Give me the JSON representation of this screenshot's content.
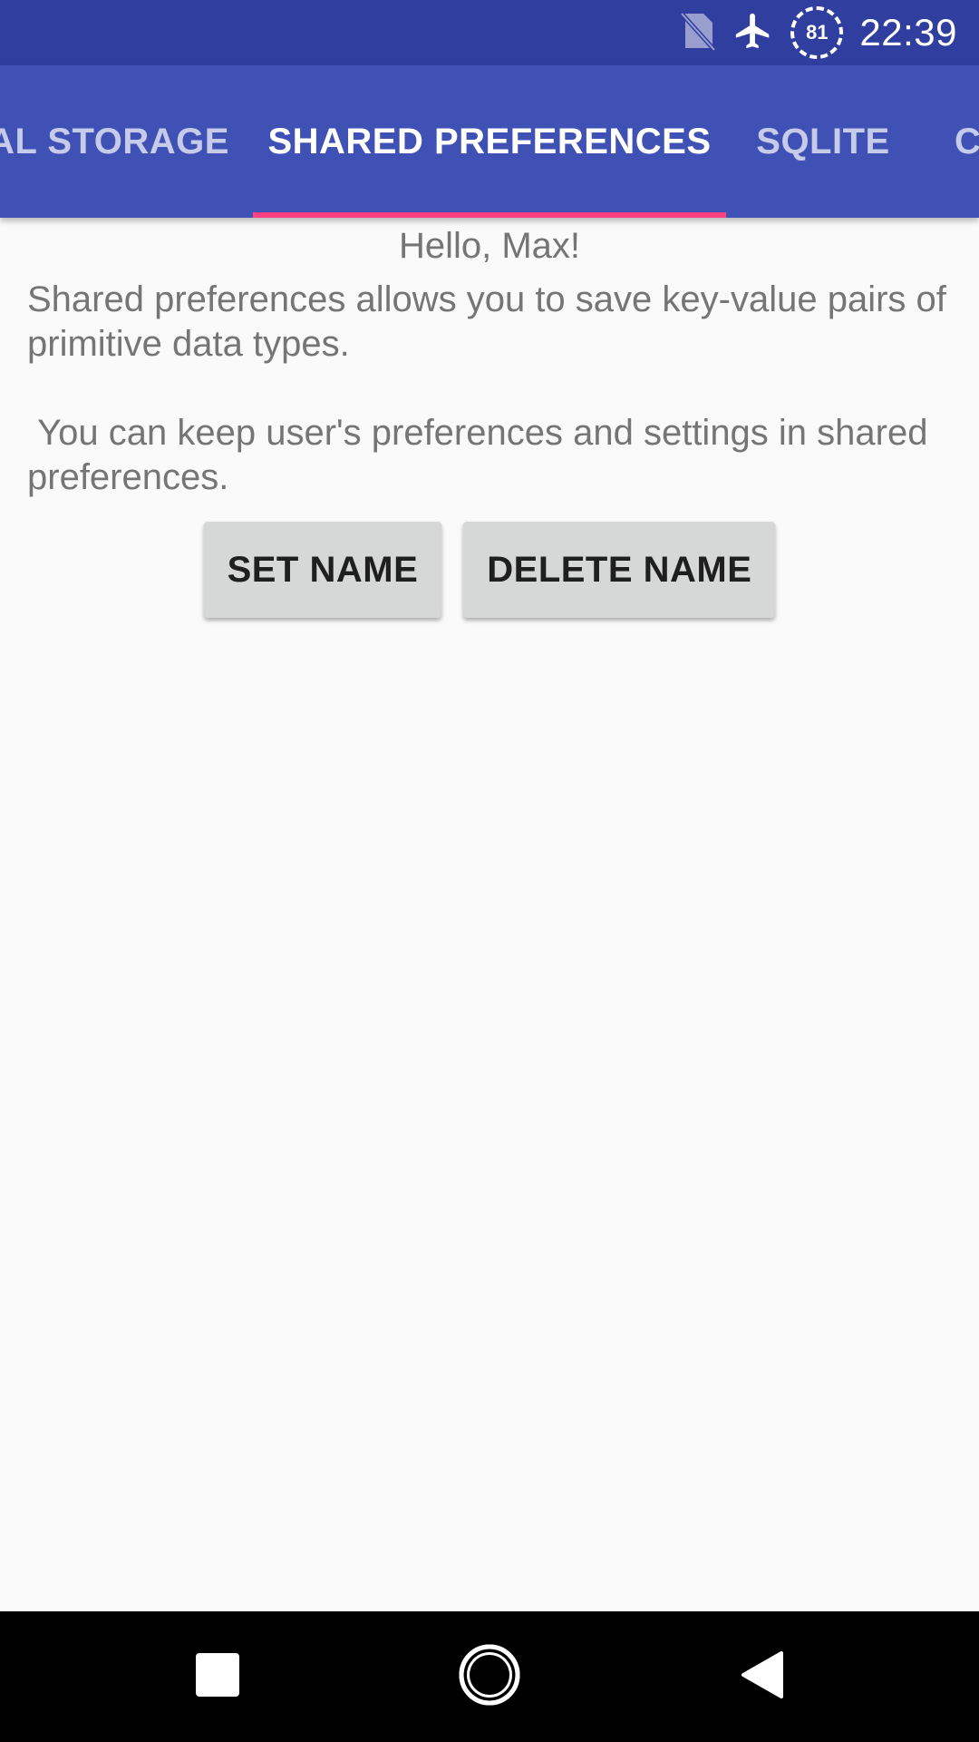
{
  "status_bar": {
    "time": "22:39",
    "battery_level": "81",
    "icons": [
      "no-sim-icon",
      "airplane-mode-icon",
      "battery-saver-icon"
    ]
  },
  "tabs": [
    {
      "label": "AL STORAGE",
      "active": false
    },
    {
      "label": "SHARED PREFERENCES",
      "active": true
    },
    {
      "label": "SQLITE",
      "active": false
    },
    {
      "label": "C",
      "active": false
    }
  ],
  "content": {
    "greeting": "Hello, Max!",
    "description_line_1": "Shared preferences allows you to save key-value pairs of primitive data types.",
    "description_line_2": " You can keep user's preferences and settings in shared preferences."
  },
  "buttons": {
    "set_name": "SET NAME",
    "delete_name": "DELETE NAME"
  },
  "colors": {
    "status_bar": "#303f9f",
    "primary": "#3f51b5",
    "accent": "#ff4081",
    "background": "#fafafa",
    "button": "#d6d7d7"
  },
  "nav_bar": {
    "icons": [
      "recents-icon",
      "home-icon",
      "back-icon"
    ]
  }
}
